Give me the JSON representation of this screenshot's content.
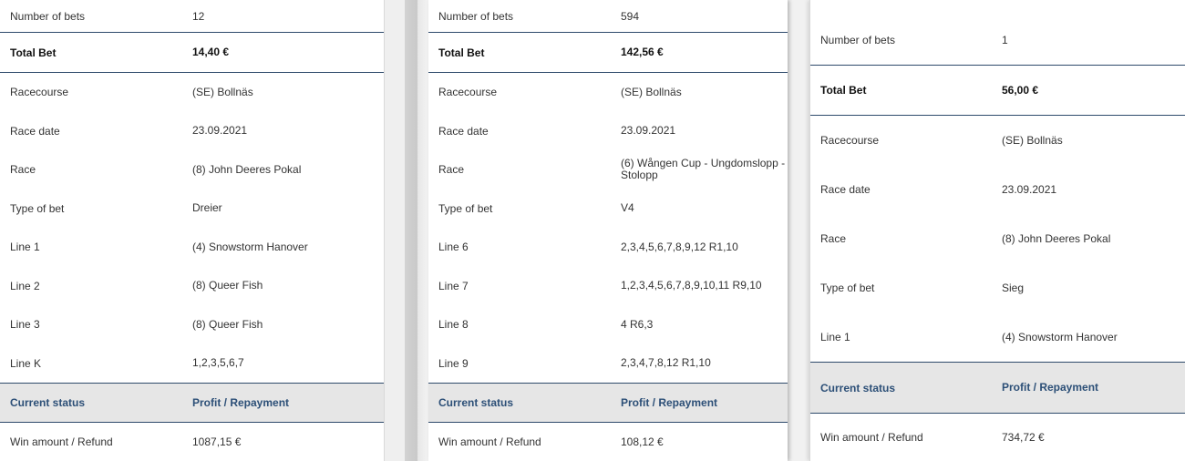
{
  "card1": {
    "number_of_bets": {
      "label": "Number of bets",
      "value": "12"
    },
    "total_bet": {
      "label": "Total Bet",
      "value": "14,40 €"
    },
    "racecourse": {
      "label": "Racecourse",
      "value": "(SE) Bollnäs"
    },
    "race_date": {
      "label": "Race date",
      "value": "23.09.2021"
    },
    "race": {
      "label": "Race",
      "value": "(8) John Deeres Pokal"
    },
    "type_of_bet": {
      "label": "Type of bet",
      "value": "Dreier"
    },
    "line_1": {
      "label": "Line 1",
      "value": "(4) Snowstorm Hanover"
    },
    "line_2": {
      "label": "Line 2",
      "value": "(8) Queer Fish"
    },
    "line_3": {
      "label": "Line 3",
      "value": "(8) Queer Fish"
    },
    "line_k": {
      "label": "Line K",
      "value": "1,2,3,5,6,7"
    },
    "status": {
      "label": "Current status",
      "value": "Profit / Repayment"
    },
    "win": {
      "label": "Win amount / Refund",
      "value": "1087,15 €"
    }
  },
  "card2": {
    "number_of_bets": {
      "label": "Number of bets",
      "value": "594"
    },
    "total_bet": {
      "label": "Total Bet",
      "value": "142,56 €"
    },
    "racecourse": {
      "label": "Racecourse",
      "value": "(SE) Bollnäs"
    },
    "race_date": {
      "label": "Race date",
      "value": "23.09.2021"
    },
    "race": {
      "label": "Race",
      "value": "(6) Wången Cup - Ungdomslopp - Stolopp"
    },
    "type_of_bet": {
      "label": "Type of bet",
      "value": "V4"
    },
    "line_6": {
      "label": "Line 6",
      "value": "2,3,4,5,6,7,8,9,12 R1,10"
    },
    "line_7": {
      "label": "Line 7",
      "value": "1,2,3,4,5,6,7,8,9,10,11 R9,10"
    },
    "line_8": {
      "label": "Line 8",
      "value": "4 R6,3"
    },
    "line_9": {
      "label": "Line 9",
      "value": "2,3,4,7,8,12 R1,10"
    },
    "status": {
      "label": "Current status",
      "value": "Profit / Repayment"
    },
    "win": {
      "label": "Win amount / Refund",
      "value": "108,12 €"
    }
  },
  "card3": {
    "number_of_bets": {
      "label": "Number of bets",
      "value": "1"
    },
    "total_bet": {
      "label": "Total Bet",
      "value": "56,00 €"
    },
    "racecourse": {
      "label": "Racecourse",
      "value": "(SE) Bollnäs"
    },
    "race_date": {
      "label": "Race date",
      "value": "23.09.2021"
    },
    "race": {
      "label": "Race",
      "value": "(8) John Deeres Pokal"
    },
    "type_of_bet": {
      "label": "Type of bet",
      "value": "Sieg"
    },
    "line_1": {
      "label": "Line 1",
      "value": "(4) Snowstorm Hanover"
    },
    "status": {
      "label": "Current status",
      "value": "Profit / Repayment"
    },
    "win": {
      "label": "Win amount / Refund",
      "value": "734,72 €"
    }
  }
}
